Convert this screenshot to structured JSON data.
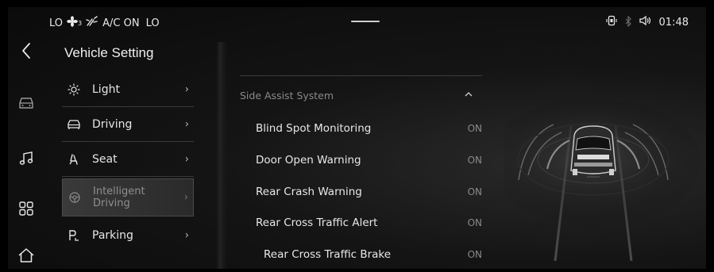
{
  "status": {
    "climate": {
      "left_temp": "LO",
      "fan_level": "3",
      "ac": "A/C ON",
      "right_temp": "LO"
    },
    "time": "01:48"
  },
  "rail": {
    "items": [
      "back-icon",
      "car-icon",
      "music-icon",
      "apps-icon",
      "home-icon"
    ]
  },
  "menu": {
    "title": "Vehicle Setting",
    "items": [
      {
        "label": "Light",
        "icon": "sun-icon"
      },
      {
        "label": "Driving",
        "icon": "car-front-icon"
      },
      {
        "label": "Seat",
        "icon": "seat-icon"
      },
      {
        "label": "Intelligent Driving",
        "label_line1": "Intelligent",
        "label_line2": "Driving",
        "icon": "steering-icon",
        "active": true
      },
      {
        "label": "Parking",
        "icon": "parking-icon"
      }
    ]
  },
  "panel": {
    "section_title": "Side Assist System",
    "rows": [
      {
        "label": "Blind Spot Monitoring",
        "value": "ON"
      },
      {
        "label": "Door Open Warning",
        "value": "ON"
      },
      {
        "label": "Rear Crash Warning",
        "value": "ON"
      },
      {
        "label": "Rear Cross Traffic Alert",
        "value": "ON"
      },
      {
        "label": "Rear Cross Traffic Brake",
        "value": "ON"
      }
    ]
  },
  "colors": {
    "background": "#0b0b0b",
    "text": "#e6e6e6",
    "muted": "#8a8a8a",
    "divider": "#3a3a3a"
  }
}
